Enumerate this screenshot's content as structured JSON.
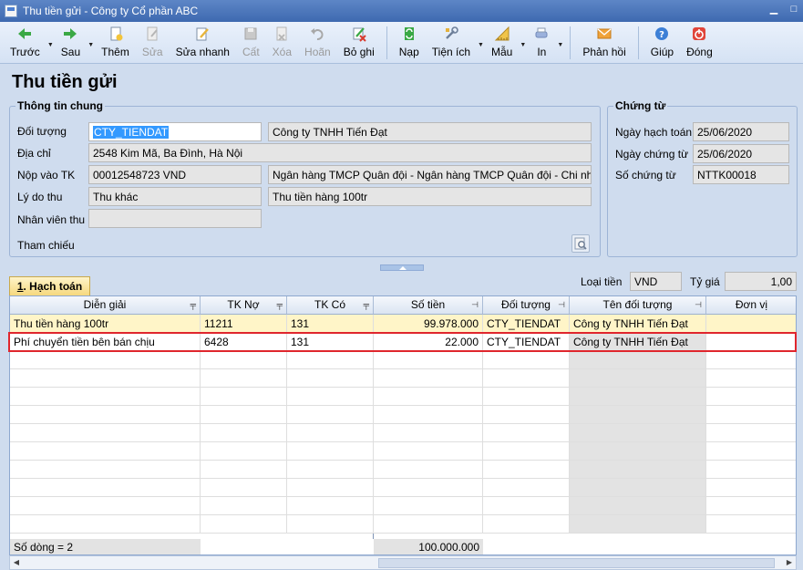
{
  "window": {
    "title": "Thu tiền gửi - Công ty Cổ phần ABC"
  },
  "toolbar": [
    {
      "label": "Trước",
      "icon": "arrow-left-icon",
      "disabled": false,
      "drop": true
    },
    {
      "label": "Sau",
      "icon": "arrow-right-icon",
      "disabled": false,
      "drop": true
    },
    {
      "label": "Thêm",
      "icon": "new-document-icon",
      "disabled": false,
      "drop": false
    },
    {
      "label": "Sửa",
      "icon": "edit-document-icon",
      "disabled": true,
      "drop": false
    },
    {
      "label": "Sửa nhanh",
      "icon": "quick-edit-icon",
      "disabled": false,
      "drop": false
    },
    {
      "label": "Cất",
      "icon": "save-disk-icon",
      "disabled": true,
      "drop": false
    },
    {
      "label": "Xóa",
      "icon": "delete-document-icon",
      "disabled": true,
      "drop": false
    },
    {
      "label": "Hoãn",
      "icon": "undo-icon",
      "disabled": true,
      "drop": false
    },
    {
      "label": "Bỏ ghi",
      "icon": "unpost-pencil-icon",
      "disabled": false,
      "drop": false
    },
    {
      "label": "Nạp",
      "icon": "refresh-icon",
      "disabled": false,
      "drop": false
    },
    {
      "label": "Tiện ích",
      "icon": "utility-tools-icon",
      "disabled": false,
      "drop": true
    },
    {
      "label": "Mẫu",
      "icon": "template-ruler-icon",
      "disabled": false,
      "drop": true
    },
    {
      "label": "In",
      "icon": "printer-icon",
      "disabled": false,
      "drop": true
    },
    {
      "label": "Phản hồi",
      "icon": "feedback-mail-icon",
      "disabled": false,
      "drop": false
    },
    {
      "label": "Giúp",
      "icon": "help-icon",
      "disabled": false,
      "drop": false
    },
    {
      "label": "Đóng",
      "icon": "close-power-icon",
      "disabled": false,
      "drop": false
    }
  ],
  "page_title": "Thu tiền gửi",
  "general": {
    "title": "Thông tin chung",
    "object_label": "Đối tượng",
    "object_code": "CTY_TIENDAT",
    "object_name": "Công ty TNHH Tiến Đạt",
    "address_label": "Địa chỉ",
    "address": "2548 Kim Mã, Ba Đình, Hà Nội",
    "account_label": "Nộp vào TK",
    "account": "00012548723 VND",
    "bank": "Ngân hàng TMCP Quân đội  - Ngân hàng TMCP Quân đội - Chi nhán",
    "reason_label": "Lý do thu",
    "reason_code": "Thu khác",
    "reason_text": "Thu tiền hàng 100tr",
    "staff_label": "Nhân viên thu",
    "staff": "",
    "reference_label": "Tham chiếu"
  },
  "voucher": {
    "title": "Chứng từ",
    "posting_date_label": "Ngày hạch toán",
    "posting_date": "25/06/2020",
    "voucher_date_label": "Ngày chứng từ",
    "voucher_date": "25/06/2020",
    "voucher_no_label": "Số chứng từ",
    "voucher_no": "NTTK00018"
  },
  "tab": {
    "label_key": "1",
    "label_rest": ". Hạch toán"
  },
  "currency": {
    "label": "Loại tiền",
    "value": "VND",
    "rate_label": "Tỷ giá",
    "rate": "1,00"
  },
  "grid": {
    "columns": [
      "Diễn giải",
      "TK Nợ",
      "TK Có",
      "Số tiền",
      "Đối tượng",
      "Tên đối tượng",
      "Đơn vị"
    ],
    "rows": [
      [
        "Thu tiền hàng 100tr",
        "11211",
        "131",
        "99.978.000",
        "CTY_TIENDAT",
        "Công ty TNHH Tiến Đạt",
        ""
      ],
      [
        "Phí chuyển tiền bên bán chịu",
        "6428",
        "131",
        "22.000",
        "CTY_TIENDAT",
        "Công ty TNHH Tiến Đạt",
        ""
      ]
    ],
    "row_count": "Số dòng = 2",
    "total": "100.000.000"
  },
  "colors": {
    "accent": "#3e69b0",
    "highlight_border": "#e0262d",
    "selected_row": "#fff5c8"
  }
}
